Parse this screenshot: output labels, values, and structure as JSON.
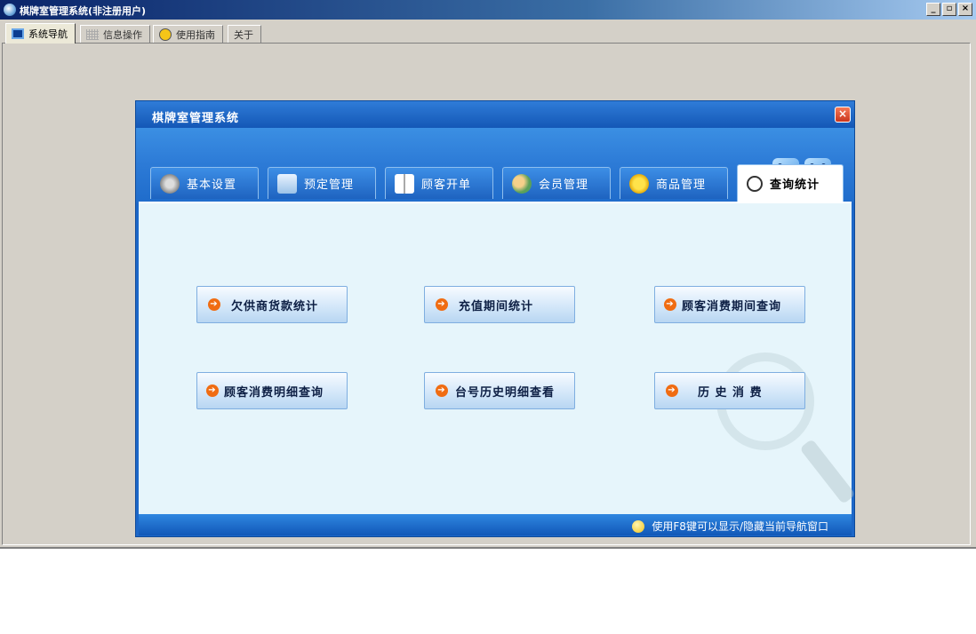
{
  "window": {
    "title": "棋牌室管理系统(非注册用户)"
  },
  "window_controls": [
    "_",
    "▫",
    "×"
  ],
  "main_tabs": [
    {
      "label": "系统导航",
      "icon": "monitor-icon"
    },
    {
      "label": "信息操作",
      "icon": "grid-icon"
    },
    {
      "label": "使用指南",
      "icon": "smiley-icon"
    },
    {
      "label": "关于",
      "icon": ""
    }
  ],
  "nav": {
    "title": "棋牌室管理系统",
    "close_label": "×",
    "tabs": [
      {
        "label": "基本设置",
        "icon": "gear-icon"
      },
      {
        "label": "预定管理",
        "icon": "monitor-icon"
      },
      {
        "label": "顾客开单",
        "icon": "book-icon"
      },
      {
        "label": "会员管理",
        "icon": "users-icon"
      },
      {
        "label": "商品管理",
        "icon": "star-icon"
      },
      {
        "label": "查询统计",
        "icon": "search-icon"
      }
    ],
    "buttons": [
      "欠供商货款统计",
      "充值期间统计",
      "顾客消费期间查询",
      "顾客消费明细查询",
      "台号历史明细查看",
      "历 史 消 费"
    ],
    "status_tip": "使用F8键可以显示/隐藏当前导航窗口"
  },
  "colors": {
    "accent": "#1c67c8",
    "button_arrow": "#f06c12",
    "body_bg": "#e6f5fb"
  }
}
